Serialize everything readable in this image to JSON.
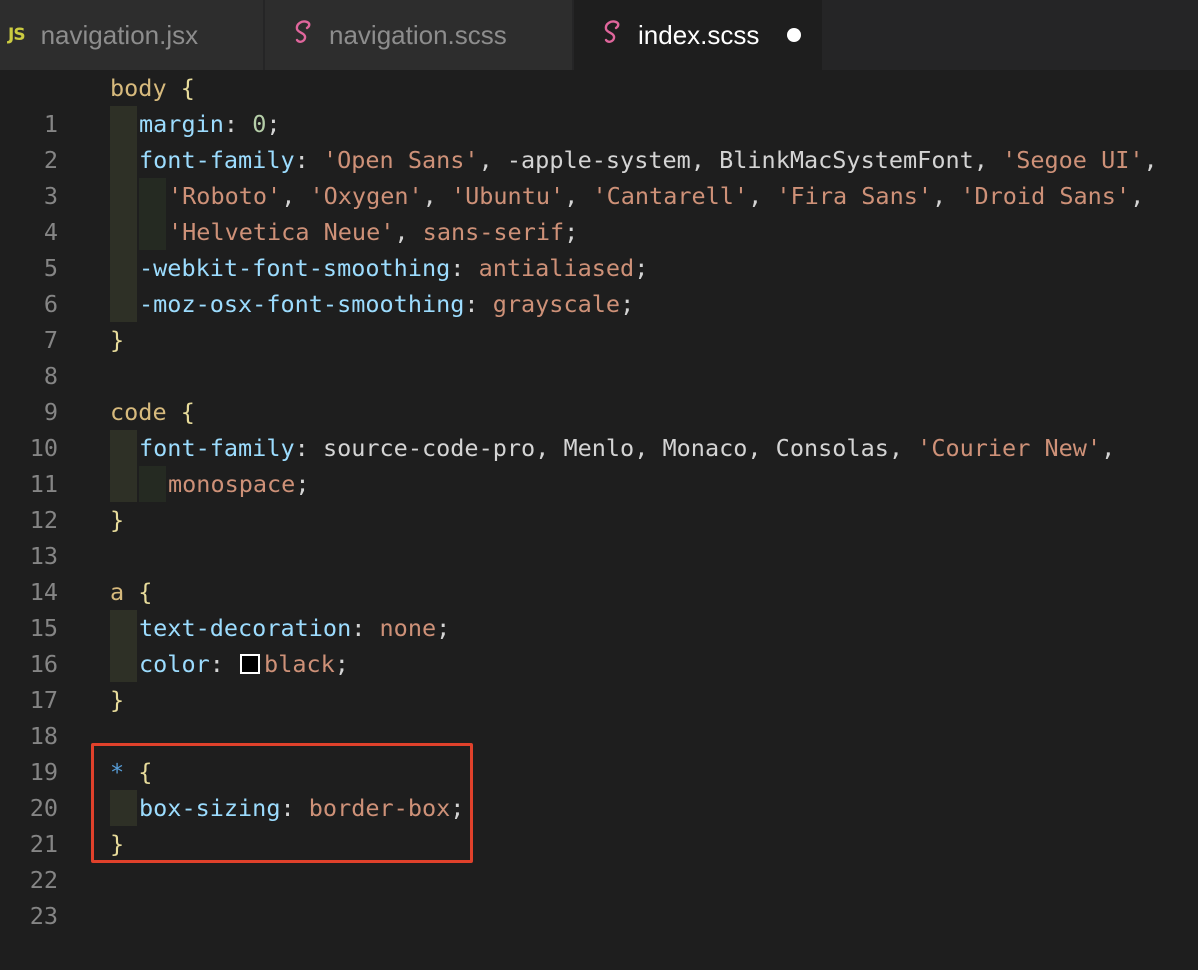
{
  "tabs": [
    {
      "label": "navigation.jsx",
      "icon": "JS",
      "active": false
    },
    {
      "label": "navigation.scss",
      "icon": "sass-icon",
      "active": false
    },
    {
      "label": "index.scss",
      "icon": "sass-icon",
      "active": true,
      "unsaved": true
    }
  ],
  "line_numbers": [
    "1",
    "2",
    "3",
    "4",
    "5",
    "6",
    "7",
    "8",
    "9",
    "10",
    "11",
    "12",
    "13",
    "14",
    "15",
    "16",
    "17",
    "18",
    "19",
    "20",
    "21",
    "22",
    "23"
  ],
  "code": {
    "l1": {
      "sel": "body",
      "brace": " {"
    },
    "l2": {
      "prop": "margin",
      "colon": ": ",
      "num": "0",
      "semi": ";"
    },
    "l3": {
      "prop": "font-family",
      "colon": ": ",
      "s1": "'Open Sans'",
      "p1": ", -apple-system, BlinkMacSystemFont, ",
      "s2": "'Segoe UI'",
      "p2": ","
    },
    "l4": {
      "s1": "'Roboto'",
      "c1": ", ",
      "s2": "'Oxygen'",
      "c2": ", ",
      "s3": "'Ubuntu'",
      "c3": ", ",
      "s4": "'Cantarell'",
      "c4": ", ",
      "s5": "'Fira Sans'",
      "c5": ", ",
      "s6": "'Droid Sans'",
      "c6": ","
    },
    "l5": {
      "s1": "'Helvetica Neue'",
      "c1": ", ",
      "v1": "sans-serif",
      "semi": ";"
    },
    "l6": {
      "prop": "-webkit-font-smoothing",
      "colon": ": ",
      "val": "antialiased",
      "semi": ";"
    },
    "l7": {
      "prop": "-moz-osx-font-smoothing",
      "colon": ": ",
      "val": "grayscale",
      "semi": ";"
    },
    "l8": {
      "brace": "}"
    },
    "l10": {
      "sel": "code",
      "brace": " {"
    },
    "l11": {
      "prop": "font-family",
      "colon": ": ",
      "p1": "source-code-pro, Menlo, Monaco, Consolas, ",
      "s1": "'Courier New'",
      "p2": ","
    },
    "l12": {
      "val": "monospace",
      "semi": ";"
    },
    "l13": {
      "brace": "}"
    },
    "l15": {
      "sel": "a",
      "brace": " {"
    },
    "l16": {
      "prop": "text-decoration",
      "colon": ": ",
      "val": "none",
      "semi": ";"
    },
    "l17": {
      "prop": "color",
      "colon": ": ",
      "val": "black",
      "semi": ";",
      "swatch_color": "#000000"
    },
    "l18": {
      "brace": "}"
    },
    "l20": {
      "sel": "*",
      "brace": " {"
    },
    "l21": {
      "prop": "box-sizing",
      "colon": ": ",
      "val": "border-box",
      "semi": ";"
    },
    "l22": {
      "brace": "}"
    }
  },
  "annotation": {
    "color": "#e0412b",
    "lines": "20-22"
  }
}
